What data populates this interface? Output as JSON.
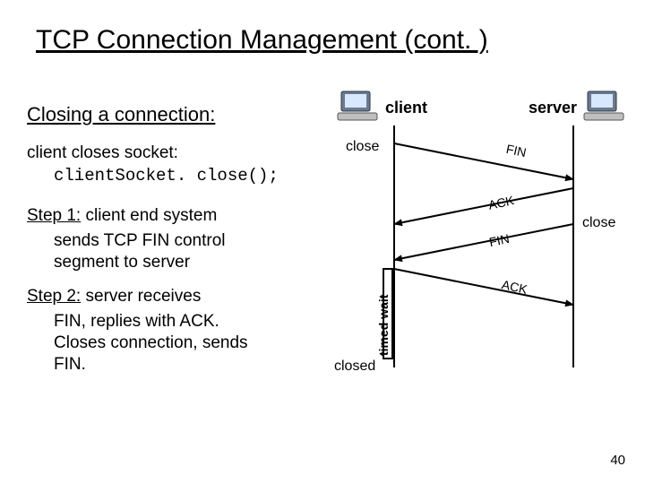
{
  "title": "TCP Connection Management (cont. )",
  "subtitle": "Closing a connection:",
  "socket": {
    "line1": "client closes socket:",
    "line2": "clientSocket. close();"
  },
  "step1": {
    "heading": "Step 1:",
    "tail1": " client end system",
    "line2": "sends TCP FIN control",
    "line3": "segment to server"
  },
  "step2": {
    "heading": "Step 2:",
    "tail1": " server receives",
    "line2": "FIN, replies with ACK.",
    "line3": "Closes connection, sends",
    "line4": "FIN."
  },
  "diagram": {
    "client_label": "client",
    "server_label": "server",
    "close_client": "close",
    "close_server": "close",
    "fin1": "FIN",
    "ack1": "ACK",
    "fin2": "FIN",
    "ack2": "ACK",
    "timed_wait": "timed wait",
    "closed": "closed"
  },
  "chart_data": {
    "type": "sequence",
    "title": "TCP four-way close handshake",
    "participants": [
      "client",
      "server"
    ],
    "events": [
      {
        "at": "client",
        "action": "close"
      },
      {
        "from": "client",
        "to": "server",
        "message": "FIN"
      },
      {
        "from": "server",
        "to": "client",
        "message": "ACK"
      },
      {
        "at": "server",
        "action": "close"
      },
      {
        "from": "server",
        "to": "client",
        "message": "FIN"
      },
      {
        "from": "client",
        "to": "server",
        "message": "ACK"
      },
      {
        "at": "client",
        "state": "timed wait"
      },
      {
        "at": "client",
        "state": "closed"
      }
    ]
  },
  "page_number": "40"
}
